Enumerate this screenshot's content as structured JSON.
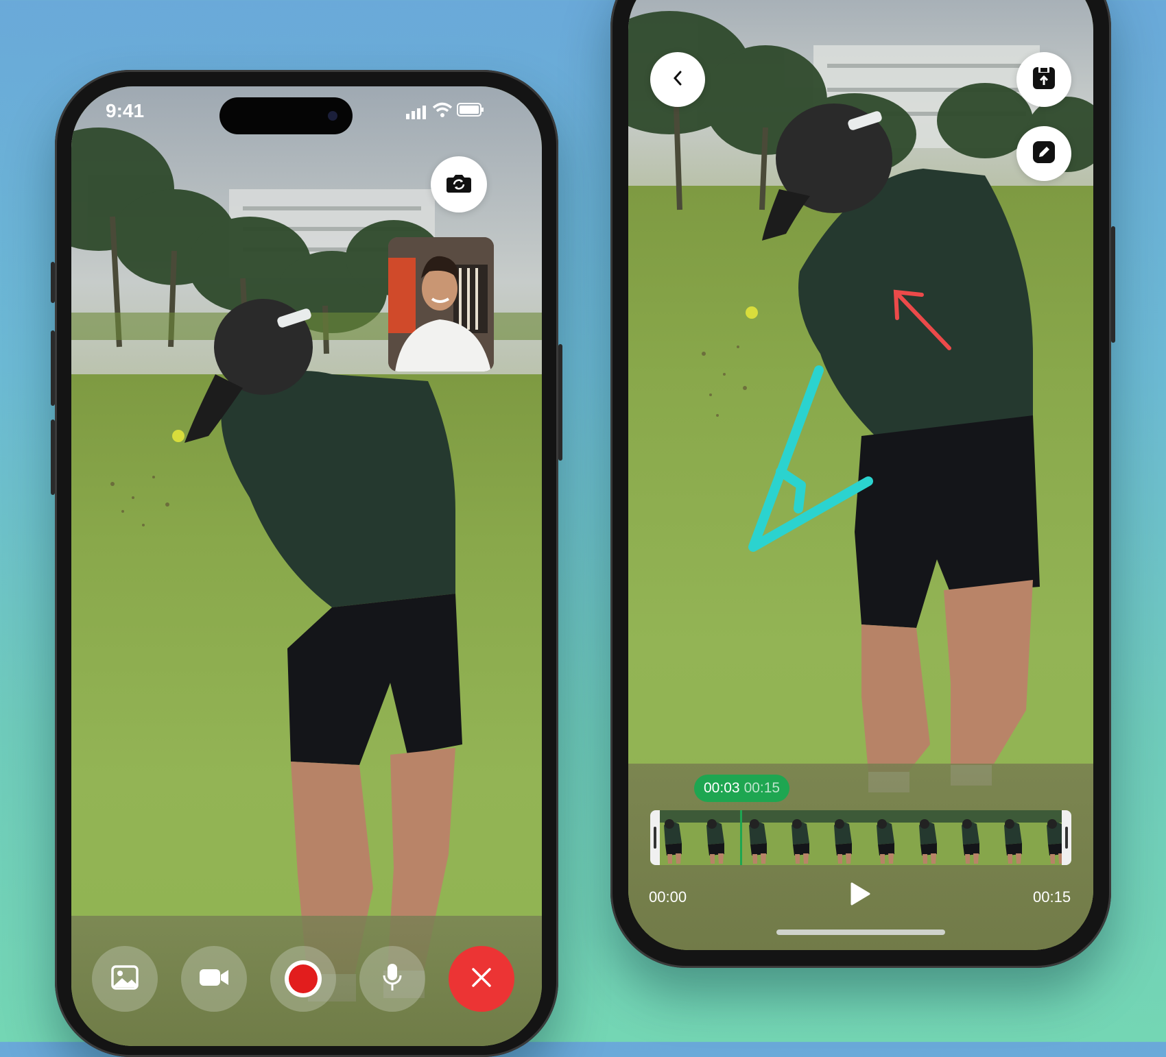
{
  "status_bar": {
    "time": "9:41"
  },
  "left_phone": {
    "pip_label": "participant video",
    "controls": [
      {
        "name": "gallery-button",
        "icon": "image-icon"
      },
      {
        "name": "camera-toggle-button",
        "icon": "video-camera-icon"
      },
      {
        "name": "record-button",
        "icon": "record-icon"
      },
      {
        "name": "microphone-button",
        "icon": "microphone-icon"
      },
      {
        "name": "end-call-button",
        "icon": "close-icon"
      }
    ]
  },
  "right_phone": {
    "timeline": {
      "current_time": "00:03",
      "total_time": "00:15",
      "start_label": "00:00",
      "end_label": "00:15",
      "progress": 0.2
    }
  },
  "colors": {
    "record_red": "#e21d1d",
    "end_call_red": "#ec3434",
    "timeline_green": "#1ea651",
    "annotation_teal": "#2bd3cf",
    "annotation_red": "#ec4a4a"
  }
}
